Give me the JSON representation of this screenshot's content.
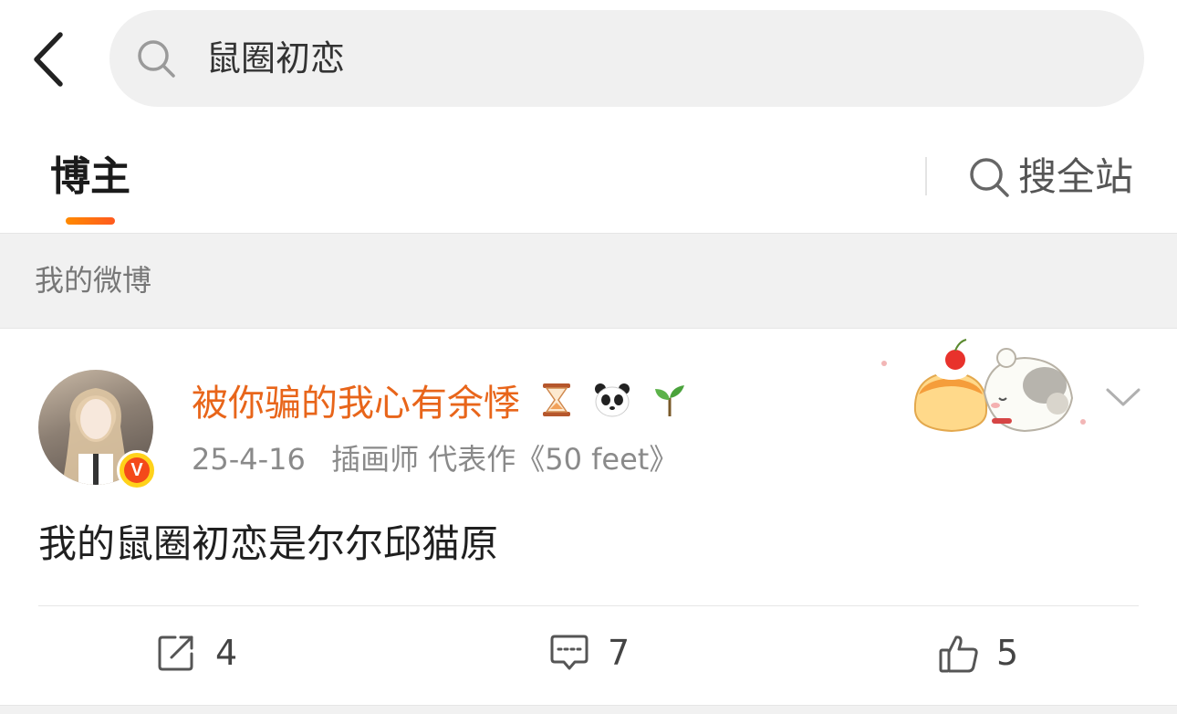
{
  "search": {
    "query": "鼠圈初恋"
  },
  "tabs": {
    "active_label": "博主",
    "search_all_label": "搜全站"
  },
  "section": {
    "label": "我的微博"
  },
  "post": {
    "username": "被你骗的我心有余悸",
    "username_emojis": [
      "hourglass",
      "panda",
      "seedling"
    ],
    "date": "25-4-16",
    "bio": "插画师 代表作《50 feet》",
    "content": "我的鼠圈初恋是尔尔邱猫原",
    "verified_badge": "V",
    "actions": {
      "repost_count": "4",
      "comment_count": "7",
      "like_count": "5"
    }
  },
  "colors": {
    "accent": "#ff6a00",
    "username": "#e8651a",
    "verified": "#ffd21a"
  }
}
